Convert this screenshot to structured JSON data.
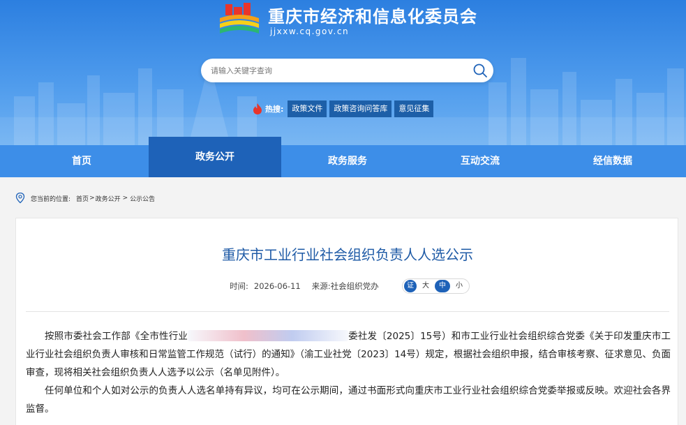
{
  "header": {
    "site_title": "重庆市经济和信息化委员会",
    "site_domain": "jjxxw.cq.gov.cn",
    "search_placeholder": "请输入关键字查询",
    "hot_label": "热搜:",
    "hot_tags": [
      "政策文件",
      "政策咨询问答库",
      "意见征集"
    ]
  },
  "nav": {
    "items": [
      "首页",
      "政务公开",
      "政务服务",
      "互动交流",
      "经信数据"
    ],
    "active": "政务公开"
  },
  "breadcrumb": {
    "label": "您当前的位置:",
    "items": [
      "首页",
      "政务公开",
      "公示公告"
    ],
    "separator": ">"
  },
  "article": {
    "title": "重庆市工业行业社会组织负责人人选公示",
    "time_label": "时间:",
    "date": "2026-06-11",
    "source_label": "来源:",
    "source": "社会组织党办",
    "font_size_icon_text": "证",
    "font_sizes": [
      "大",
      "中",
      "小"
    ],
    "font_size_active": "中",
    "paragraph1_before": "按照市委社会工作部《全市性行业",
    "paragraph1_after": "委社发〔2025〕15号）和市工业行业社会组织综合党委《关于印发重庆市工业行业社会组织负责人审核和日常监管工作规范（试行）的通知》（渝工业社党〔2023〕14号）规定，根据社会组织申报，结合审核考察、征求意见、负面审查，现将相关社会组织负责人人选予以公示（名单见附件）。",
    "paragraph2": "任何单位和个人如对公示的负责人人选名单持有异议，均可在公示期间，通过书面形式向重庆市工业行业社会组织综合党委举报或反映。欢迎社会各界监督。"
  },
  "colors": {
    "header_blue": "#2c7fe0",
    "nav_blue": "#3d8ee8",
    "nav_active": "#1e62b8",
    "title_blue": "#1e5aa6"
  }
}
